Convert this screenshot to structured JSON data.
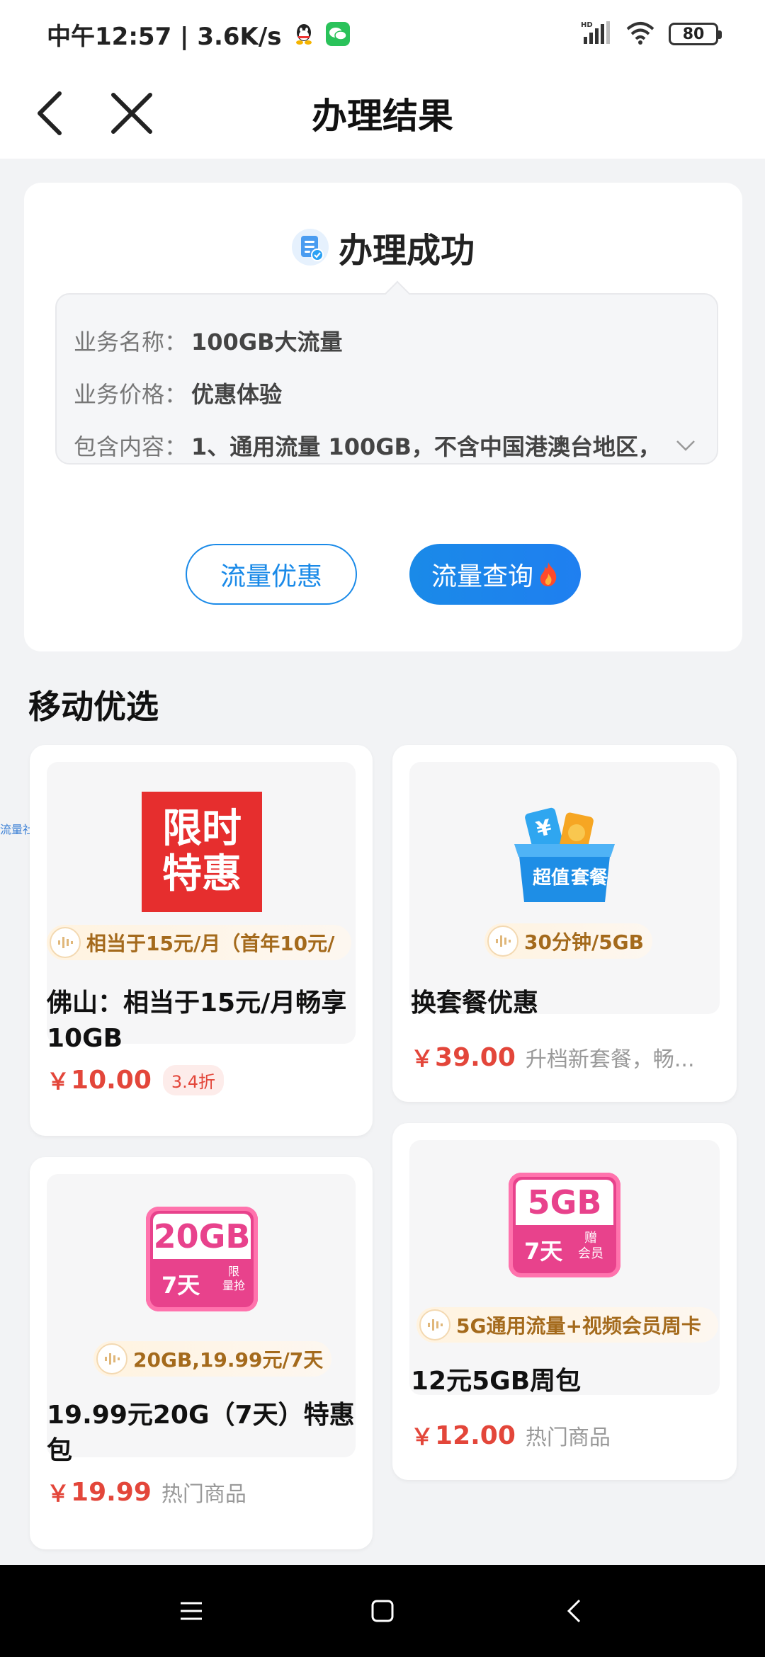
{
  "status_bar": {
    "time": "中午12:57 | 3.6K/s",
    "battery": "80",
    "network": "HD"
  },
  "nav": {
    "title": "办理结果"
  },
  "result": {
    "title": "办理成功",
    "details": [
      {
        "label": "业务名称：",
        "value": "100GB大流量"
      },
      {
        "label": "业务价格：",
        "value": "优惠体验"
      },
      {
        "label": "包含内容：",
        "value": "1、通用流量 100GB，不含中国港澳台地区，"
      }
    ],
    "buttons": {
      "outline": "流量优惠",
      "primary": "流量查询"
    }
  },
  "section": {
    "title": "移动优选",
    "side_tag": "流量社区"
  },
  "products": [
    {
      "badge_lines": [
        "限时",
        "特惠"
      ],
      "tag": "相当于15元/月（首年10元/",
      "name": "佛山：相当于15元/月畅享10GB",
      "price_symbol": "￥",
      "price": "10.00",
      "discount": "3.4折"
    },
    {
      "badge_text": [
        "超值",
        "套餐"
      ],
      "tag": "30分钟/5GB",
      "name": "换套餐优惠",
      "price_symbol": "￥",
      "price": "39.00",
      "note": "升档新套餐，畅..."
    },
    {
      "badge_big": "20GB",
      "badge_days": "7天",
      "badge_corner": [
        "限",
        "量抢"
      ],
      "tag": "20GB,19.99元/7天",
      "name": "19.99元20G（7天）特惠包",
      "price_symbol": "￥",
      "price": "19.99",
      "note": "热门商品"
    },
    {
      "badge_big": "5GB",
      "badge_days": "7天",
      "badge_corner": [
        "赠",
        "会员"
      ],
      "tag": "5G通用流量+视频会员周卡",
      "name": "12元5GB周包",
      "price_symbol": "￥",
      "price": "12.00",
      "note": "热门商品"
    }
  ],
  "colors": {
    "primary_blue": "#1a8ae8",
    "price_red": "#e3463a",
    "badge_red": "#e62e2e",
    "badge_pink": "#e8428c"
  }
}
